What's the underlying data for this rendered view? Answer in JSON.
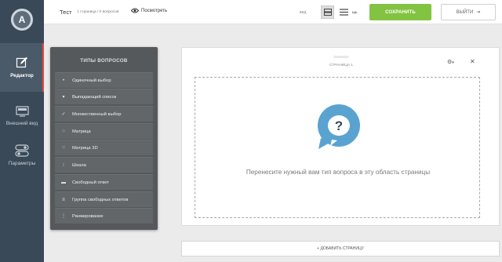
{
  "brand": {
    "logo_letter": "A"
  },
  "sidebar": {
    "items": [
      {
        "label": "Редактор"
      },
      {
        "label": "Внешний вид"
      },
      {
        "label": "Параметры"
      }
    ]
  },
  "topbar": {
    "survey_title": "Тест",
    "survey_meta": "1 страница / 0 вопросов",
    "preview_label": "Посмотреть",
    "view_label": "вид",
    "view_extra": "щь",
    "save_label": "СОХРАНИТЬ",
    "exit_label": "ВЫЙТИ"
  },
  "question_types": {
    "title": "ТИПЫ ВОПРОСОВ",
    "items": [
      {
        "label": "Одиночный выбор",
        "icon": "dot-icon"
      },
      {
        "label": "Выпадающий список",
        "icon": "dropdown-arrow-icon"
      },
      {
        "label": "Множественный выбор",
        "icon": "checkmark-icon"
      },
      {
        "label": "Матрица",
        "icon": "matrix-icon"
      },
      {
        "label": "Матрица 3D",
        "icon": "matrix-3d-icon"
      },
      {
        "label": "Шкала",
        "icon": "scale-icon"
      },
      {
        "label": "Свободный ответ",
        "icon": "text-field-icon"
      },
      {
        "label": "Группа свободных ответов",
        "icon": "text-group-icon"
      },
      {
        "label": "Ранжирование",
        "icon": "ranking-icon"
      }
    ]
  },
  "page": {
    "label": "СТРАНИЦА 1",
    "drop_text": "Перенесите нужный вам тип вопроса в эту область страницы",
    "add_page_label": "+ ДОБАВИТЬ СТРАНИЦУ"
  },
  "colors": {
    "sidebar_bg": "#3a4957",
    "accent_red": "#e8463b",
    "save_green": "#82c341",
    "question_bubble": "#5aa3d0"
  }
}
